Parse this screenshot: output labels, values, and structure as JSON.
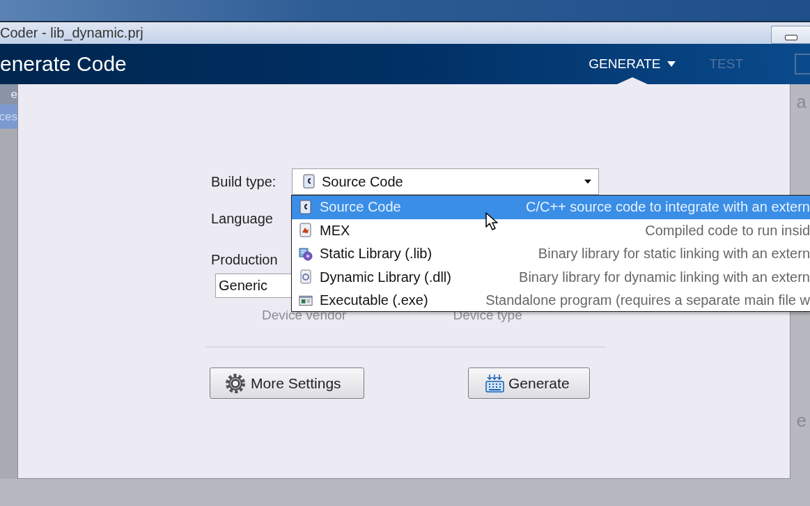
{
  "window": {
    "title": "Coder - lib_dynamic.prj"
  },
  "header": {
    "title": "enerate Code",
    "tabs": [
      {
        "label": "GENERATE",
        "selected": true,
        "disabled": false,
        "has_menu": true
      },
      {
        "label": "TEST",
        "selected": false,
        "disabled": true,
        "has_menu": false
      }
    ]
  },
  "sidebar": {
    "items": [
      {
        "label": "e",
        "selected": false
      },
      {
        "label": "ces",
        "selected": true
      }
    ]
  },
  "form": {
    "build_type": {
      "label": "Build type:",
      "value": "Source Code",
      "kind": "source"
    },
    "language": {
      "label": "Language"
    },
    "production": {
      "label": "Production",
      "vendor_value": "Generic",
      "vendor_caption": "Device vendor",
      "type_caption": "Device type"
    }
  },
  "dropdown_list": {
    "items": [
      {
        "kind": "source",
        "name": "Source Code",
        "description": "C/C++ source code to integrate with an extern",
        "selected": true
      },
      {
        "kind": "mex",
        "name": "MEX",
        "description": "Compiled code to run insid",
        "selected": false
      },
      {
        "kind": "static",
        "name": "Static Library (.lib)",
        "description": "Binary library for static linking with an extern",
        "selected": false
      },
      {
        "kind": "dynamic",
        "name": "Dynamic Library (.dll)",
        "description": "Binary library for dynamic linking with an extern",
        "selected": false
      },
      {
        "kind": "exe",
        "name": "Executable (.exe)",
        "description": "Standalone program (requires a separate main file w",
        "selected": false
      }
    ]
  },
  "buttons": [
    {
      "label": "More Settings",
      "kind": "gear"
    },
    {
      "label": "Generate",
      "kind": "generate"
    }
  ],
  "background_text": [
    "a",
    "e"
  ]
}
